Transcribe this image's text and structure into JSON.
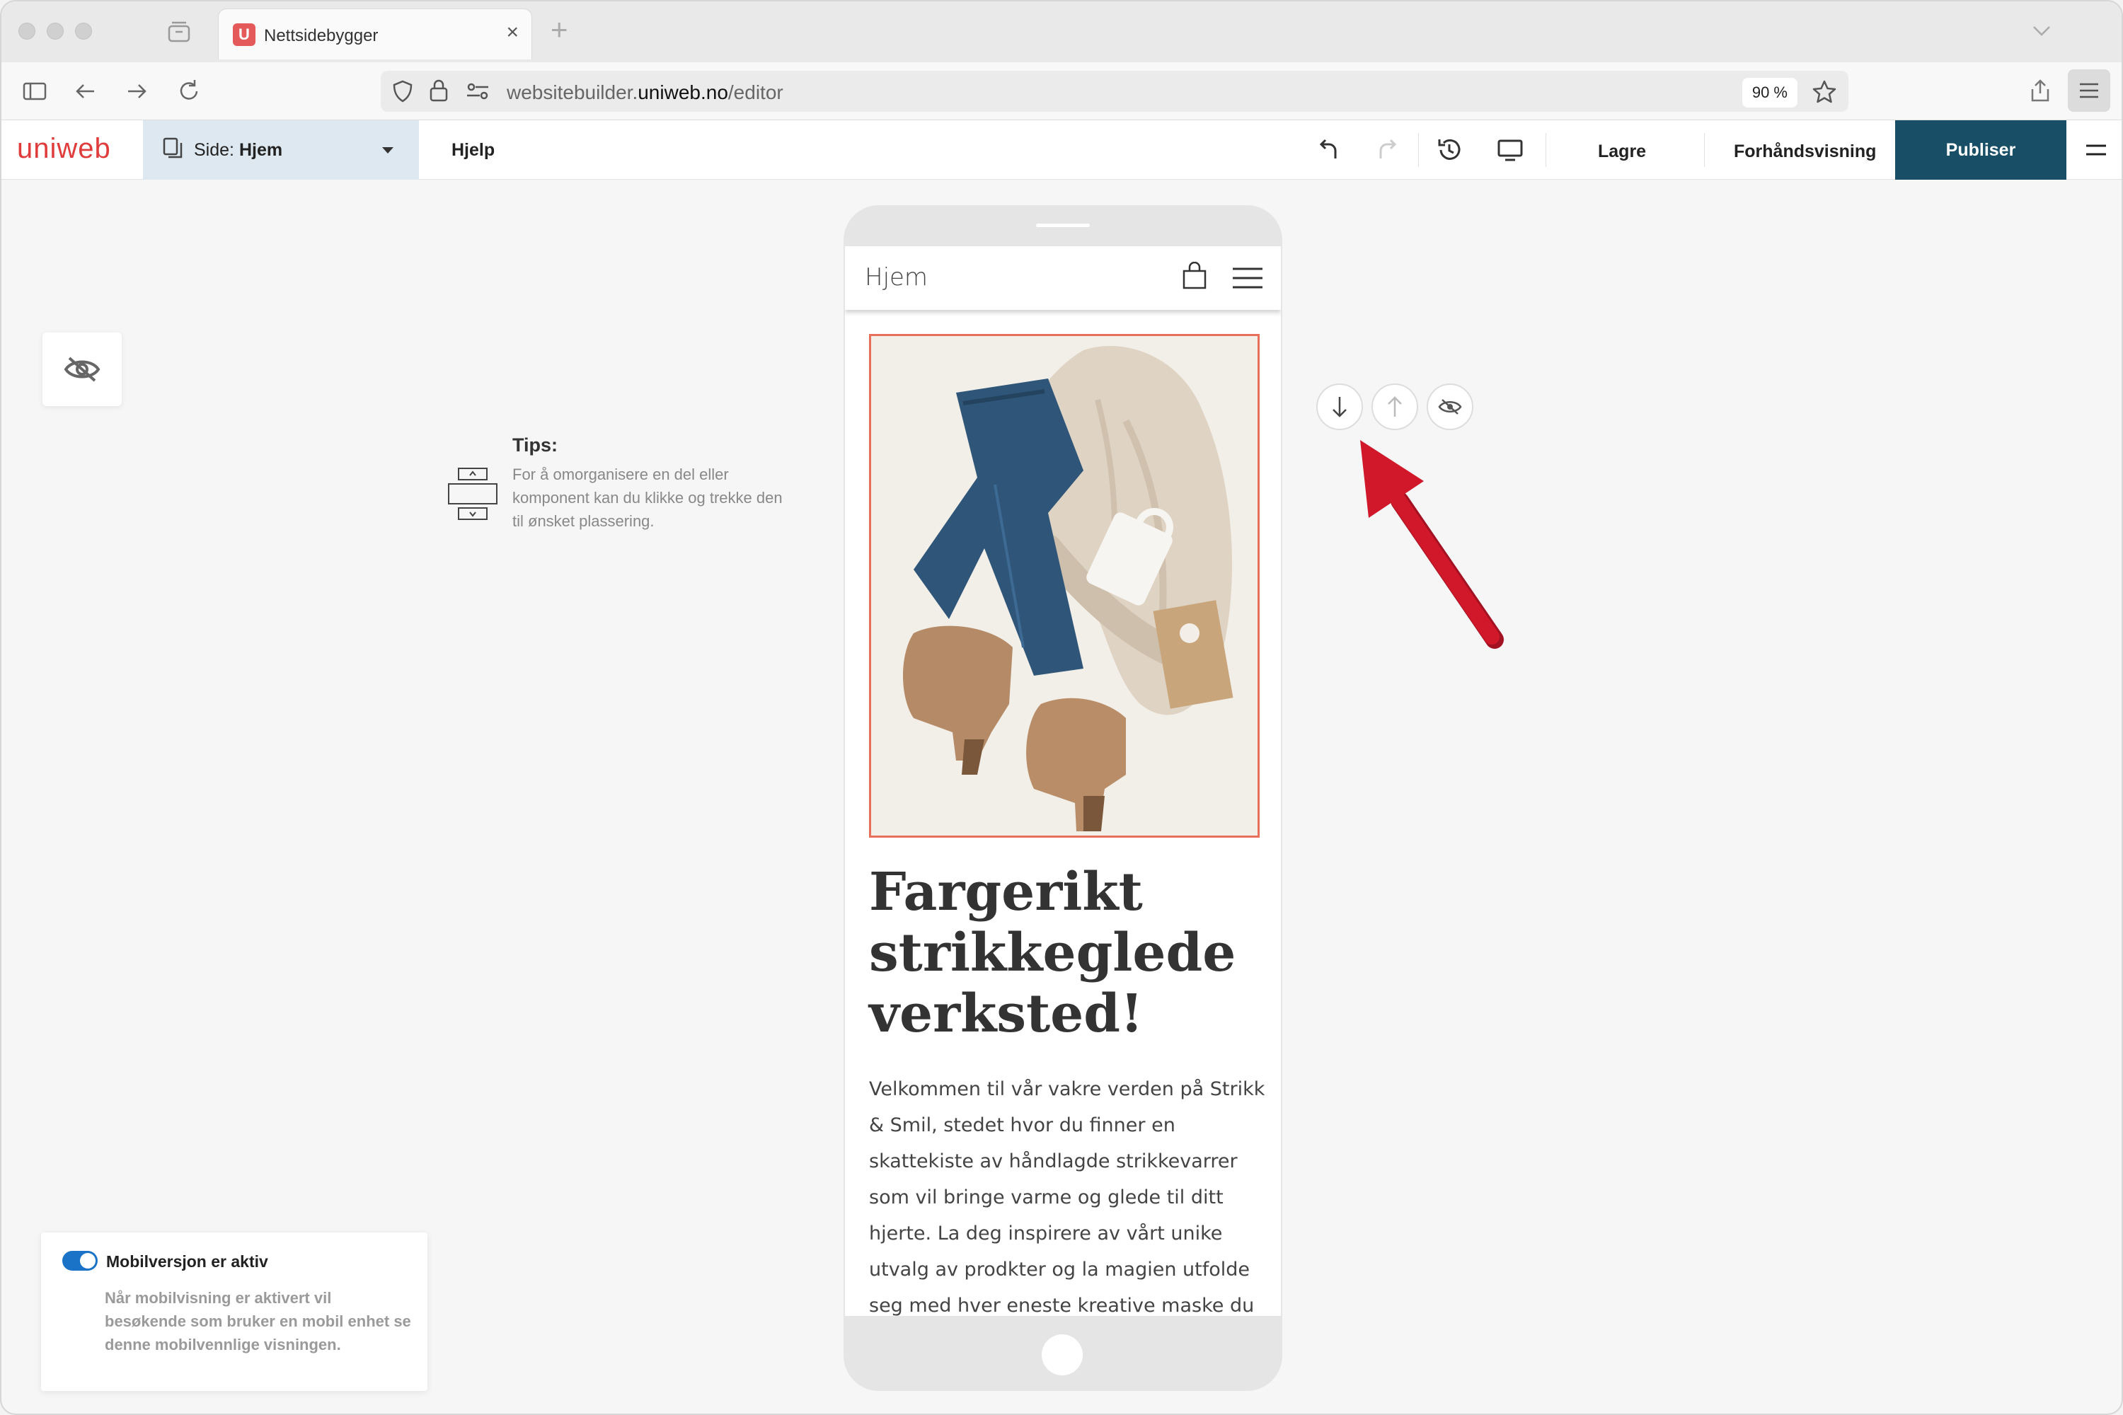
{
  "browser": {
    "tab_title": "Nettsidebygger",
    "tab_favicon": "U",
    "url_prefix": "websitebuilder.",
    "url_domain": "uniweb.no",
    "url_path": "/editor",
    "zoom": "90 %"
  },
  "editor": {
    "logo": "uniweb",
    "page_prefix": "Side: ",
    "page_name": "Hjem",
    "help": "Hjelp",
    "save": "Lagre",
    "preview": "Forhåndsvisning",
    "publish": "Publiser"
  },
  "tips": {
    "title": "Tips:",
    "text": "For å omorganisere en del eller komponent kan du klikke og trekke den til ønsket plassering."
  },
  "mobile_preview": {
    "header_title": "Hjem",
    "heading": "Fargerikt strikkeglede verksted!",
    "body": "Velkommen til vår vakre verden på Strikk & Smil, stedet hvor du finner en skattekiste av håndlagde strikkevarrer som vil bringe varme og glede til ditt hjerte. La deg inspirere av vårt unike utvalg av prodkter og la magien utfolde seg med hver eneste kreative maske du"
  },
  "mobile_info": {
    "title": "Mobilversjon er aktiv",
    "text": "Når mobilvisning er aktivert vil besøkende som bruker en mobil enhet se denne mobilvennlige visningen."
  },
  "colors": {
    "publish_bg": "#194f66",
    "logo": "#e03c3c",
    "selection_border": "#e8705a",
    "annotation_arrow": "#d0182a",
    "toggle_on": "#1b73c7"
  }
}
